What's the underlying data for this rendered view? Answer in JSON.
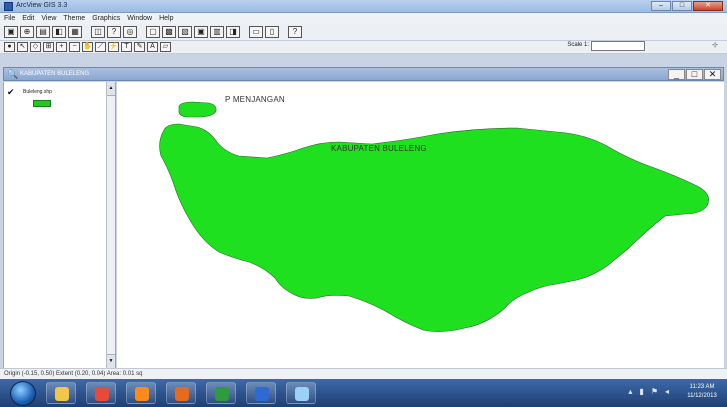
{
  "window": {
    "title": "ArcView GIS 3.3",
    "controls": {
      "minimize": "–",
      "maximize": "□",
      "close": "✕"
    }
  },
  "menu": [
    "File",
    "Edit",
    "View",
    "Theme",
    "Graphics",
    "Window",
    "Help"
  ],
  "toolbar1": {
    "buttons": [
      {
        "name": "save-button",
        "icon": "save-icon",
        "glyph": "▣"
      },
      {
        "name": "add-theme-button",
        "icon": "add-theme-icon",
        "glyph": "⊕"
      },
      {
        "name": "theme-props-button",
        "icon": "properties-icon",
        "glyph": "▤"
      },
      {
        "name": "legend-editor-button",
        "icon": "legend-icon",
        "glyph": "◧"
      },
      {
        "name": "table-button",
        "icon": "table-icon",
        "glyph": "▦"
      },
      {
        "name": "gap",
        "glyph": ""
      },
      {
        "name": "open-button",
        "icon": "open-icon",
        "glyph": "◫"
      },
      {
        "name": "query-button",
        "icon": "query-icon",
        "glyph": "?"
      },
      {
        "name": "locate-button",
        "icon": "locate-icon",
        "glyph": "◎"
      },
      {
        "name": "gap",
        "glyph": ""
      },
      {
        "name": "zoom-extent-button",
        "icon": "zoom-extent-icon",
        "glyph": "▢"
      },
      {
        "name": "zoom-themes-button",
        "icon": "zoom-themes-icon",
        "glyph": "▩"
      },
      {
        "name": "zoom-selected-button",
        "icon": "zoom-selected-icon",
        "glyph": "▧"
      },
      {
        "name": "zoom-in-fixed-button",
        "icon": "zoom-in-fixed-icon",
        "glyph": "▣"
      },
      {
        "name": "zoom-out-fixed-button",
        "icon": "zoom-out-fixed-icon",
        "glyph": "▥"
      },
      {
        "name": "zoom-previous-button",
        "icon": "zoom-previous-icon",
        "glyph": "◨"
      },
      {
        "name": "gap",
        "glyph": ""
      },
      {
        "name": "select-features-button",
        "icon": "select-features-icon",
        "glyph": "▭"
      },
      {
        "name": "clear-selection-button",
        "icon": "clear-selection-icon",
        "glyph": "▯"
      },
      {
        "name": "gap",
        "glyph": ""
      },
      {
        "name": "help-button",
        "icon": "help-icon",
        "glyph": "?"
      }
    ]
  },
  "toolbar2": {
    "buttons": [
      {
        "name": "identify-tool",
        "icon": "identify-icon",
        "glyph": "●"
      },
      {
        "name": "pointer-tool",
        "icon": "pointer-icon",
        "glyph": "↖"
      },
      {
        "name": "vertex-tool",
        "icon": "vertex-icon",
        "glyph": "◇"
      },
      {
        "name": "select-tool",
        "icon": "select-icon",
        "glyph": "⊞"
      },
      {
        "name": "zoom-in-tool",
        "icon": "zoom-in-icon",
        "glyph": "+"
      },
      {
        "name": "zoom-out-tool",
        "icon": "zoom-out-icon",
        "glyph": "−"
      },
      {
        "name": "pan-tool",
        "icon": "pan-icon",
        "glyph": "✋"
      },
      {
        "name": "measure-tool",
        "icon": "measure-icon",
        "glyph": "⟋"
      },
      {
        "name": "hotlink-tool",
        "icon": "hotlink-icon",
        "glyph": "⚡"
      },
      {
        "name": "text-tool",
        "icon": "text-icon",
        "glyph": "T"
      },
      {
        "name": "draw-tool",
        "icon": "draw-icon",
        "glyph": "✎"
      },
      {
        "name": "label-tool",
        "icon": "label-icon",
        "glyph": "A"
      },
      {
        "name": "area-tool",
        "icon": "area-icon",
        "glyph": "▱"
      }
    ],
    "scale_label": "Scale 1:",
    "scale_value": "",
    "coord_glyph": "⊹"
  },
  "view": {
    "title": "KABUPATEN BULELENG",
    "controls": {
      "minimize": "_",
      "maximize": "□",
      "close": "✕"
    }
  },
  "toc": {
    "theme_name": "Buleleng.shp",
    "checked": true,
    "check_glyph": "✔",
    "swatch_color": "#1ecc1e"
  },
  "map": {
    "fill_color": "#1ee01e",
    "labels": {
      "menjangan": "P MENJANGAN",
      "buleleng": "KABUPATEN BULELENG"
    }
  },
  "status": {
    "text": "Origin (-0.15, 0.50)   Extent (0.20, 0.04)   Area: 0.01 sq"
  },
  "taskbar": {
    "apps": [
      {
        "name": "explorer-task",
        "icon": "folder-icon",
        "color": "#f1c64a"
      },
      {
        "name": "chrome-task",
        "icon": "chrome-icon",
        "color": "#e44b3a"
      },
      {
        "name": "media-task",
        "icon": "media-icon",
        "color": "#ff8a1c"
      },
      {
        "name": "firefox-task",
        "icon": "firefox-icon",
        "color": "#e86a1c"
      },
      {
        "name": "excel-task",
        "icon": "excel-icon",
        "color": "#2f9b3f"
      },
      {
        "name": "word-task",
        "icon": "word-icon",
        "color": "#2d6ad1"
      },
      {
        "name": "arcview-task",
        "icon": "arcview-icon",
        "color": "#9bd1f5"
      }
    ],
    "clock_time": "11:23 AM",
    "clock_date": "11/12/2013"
  }
}
